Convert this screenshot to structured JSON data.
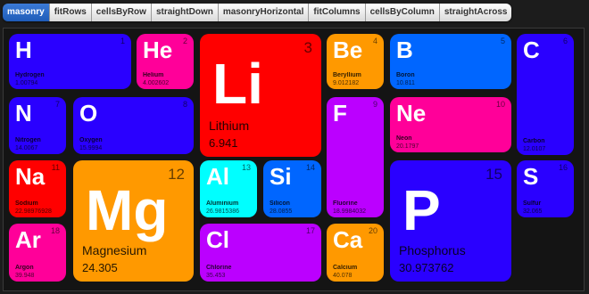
{
  "toolbar": {
    "buttons": [
      {
        "label": "masonry",
        "active": true
      },
      {
        "label": "fitRows",
        "active": false
      },
      {
        "label": "cellsByRow",
        "active": false
      },
      {
        "label": "straightDown",
        "active": false
      },
      {
        "label": "masonryHorizontal",
        "active": false
      },
      {
        "label": "fitColumns",
        "active": false
      },
      {
        "label": "cellsByColumn",
        "active": false
      },
      {
        "label": "straightAcross",
        "active": false
      }
    ]
  },
  "colors": {
    "alkali": "#ff0000",
    "noble": "#ff0099",
    "alkaline": "#ff9900",
    "metalloid": "#0066ff",
    "nonmetal": "#2a00ff",
    "halogen": "#bb00ff",
    "metal": "#00ffff",
    "active_button": "#2a6ccc"
  },
  "elements": [
    {
      "symbol": "H",
      "number": "1",
      "name": "Hydrogen",
      "weight": "1.00794",
      "category": "nonmetal"
    },
    {
      "symbol": "He",
      "number": "2",
      "name": "Helium",
      "weight": "4.002602",
      "category": "noble"
    },
    {
      "symbol": "Li",
      "number": "3",
      "name": "Lithium",
      "weight": "6.941",
      "category": "alkali"
    },
    {
      "symbol": "Be",
      "number": "4",
      "name": "Beryllium",
      "weight": "9.012182",
      "category": "alkaline"
    },
    {
      "symbol": "B",
      "number": "5",
      "name": "Boron",
      "weight": "10.811",
      "category": "metalloid"
    },
    {
      "symbol": "C",
      "number": "6",
      "name": "Carbon",
      "weight": "12.0107",
      "category": "nonmetal"
    },
    {
      "symbol": "N",
      "number": "7",
      "name": "Nitrogen",
      "weight": "14.0067",
      "category": "nonmetal"
    },
    {
      "symbol": "O",
      "number": "8",
      "name": "Oxygen",
      "weight": "15.9994",
      "category": "nonmetal"
    },
    {
      "symbol": "F",
      "number": "9",
      "name": "Fluorine",
      "weight": "18.9984032",
      "category": "halogen"
    },
    {
      "symbol": "Ne",
      "number": "10",
      "name": "Neon",
      "weight": "20.1797",
      "category": "noble"
    },
    {
      "symbol": "Na",
      "number": "11",
      "name": "Sodium",
      "weight": "22.98976928",
      "category": "alkali"
    },
    {
      "symbol": "Mg",
      "number": "12",
      "name": "Magnesium",
      "weight": "24.305",
      "category": "alkaline"
    },
    {
      "symbol": "Al",
      "number": "13",
      "name": "Aluminium",
      "weight": "26.9815386",
      "category": "metal"
    },
    {
      "symbol": "Si",
      "number": "14",
      "name": "Silicon",
      "weight": "28.0855",
      "category": "metalloid"
    },
    {
      "symbol": "P",
      "number": "15",
      "name": "Phosphorus",
      "weight": "30.973762",
      "category": "nonmetal"
    },
    {
      "symbol": "S",
      "number": "16",
      "name": "Sulfur",
      "weight": "32.065",
      "category": "nonmetal"
    },
    {
      "symbol": "Cl",
      "number": "17",
      "name": "Chlorine",
      "weight": "35.453",
      "category": "halogen"
    },
    {
      "symbol": "Ar",
      "number": "18",
      "name": "Argon",
      "weight": "39.948",
      "category": "noble"
    },
    {
      "symbol": "Ca",
      "number": "20",
      "name": "Calcium",
      "weight": "40.078",
      "category": "alkaline"
    }
  ]
}
